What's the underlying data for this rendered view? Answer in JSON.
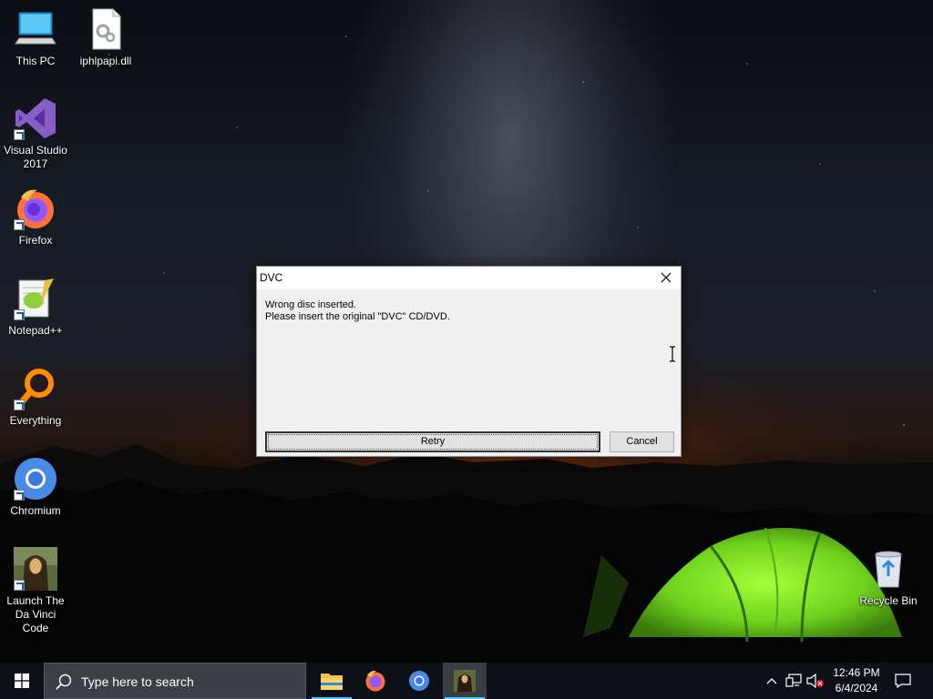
{
  "desktop": {
    "icons": [
      {
        "label": "This PC"
      },
      {
        "label": "iphlpapi.dll"
      },
      {
        "label": "Visual Studio 2017"
      },
      {
        "label": "Firefox"
      },
      {
        "label": "Notepad++"
      },
      {
        "label": "Everything"
      },
      {
        "label": "Chromium"
      },
      {
        "label": "Launch The Da Vinci Code"
      },
      {
        "label": "Recycle Bin"
      }
    ]
  },
  "dialog": {
    "title": "DVC",
    "message_line1": "Wrong disc inserted.",
    "message_line2": "Please insert the original \"DVC\" CD/DVD.",
    "retry_label": "Retry",
    "cancel_label": "Cancel"
  },
  "taskbar": {
    "search_placeholder": "Type here to search",
    "apps": [
      {
        "icon": "file-explorer-icon"
      },
      {
        "icon": "firefox-icon"
      },
      {
        "icon": "chromium-icon"
      },
      {
        "icon": "da-vinci-code-icon"
      }
    ],
    "clock_time": "12:46 PM",
    "clock_date": "6/4/2024"
  },
  "colors": {
    "accent": "#4cc2ff",
    "taskbar": "#0d1117",
    "dialog_bg": "#f0f0f0"
  }
}
